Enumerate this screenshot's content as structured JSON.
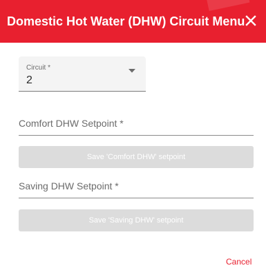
{
  "header": {
    "title": "Domestic Hot Water (DHW) Circuit Menu",
    "close_icon": "close-icon",
    "color": "#e8202f"
  },
  "circuit": {
    "label": "Circuit *",
    "value": "2",
    "arrow_icon": "arrow-drop-down-icon"
  },
  "comfort": {
    "placeholder": "Comfort DHW Setpoint *",
    "value": "",
    "save_label": "Save 'Comfort DHW' setpoint",
    "save_disabled": true
  },
  "saving": {
    "placeholder": "Saving DHW Setpoint *",
    "value": "",
    "save_label": "Save 'Saving DHW' setpoint",
    "save_disabled": true
  },
  "footer": {
    "cancel_label": "Cancel"
  }
}
